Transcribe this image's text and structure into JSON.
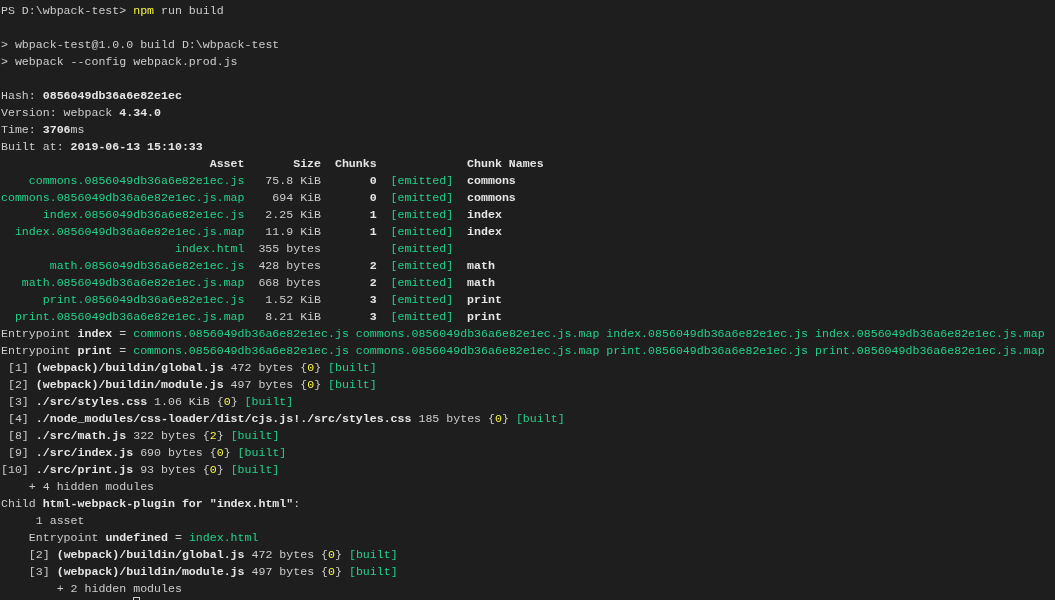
{
  "terminal": {
    "lines_before": [
      {
        "kind": "text",
        "segments": [
          {
            "text": "PS D:\\wbpack-test> "
          },
          {
            "text": "npm",
            "kind": "command"
          },
          {
            "text": " run build"
          }
        ]
      },
      {
        "kind": "blank"
      },
      {
        "kind": "text",
        "segments": [
          {
            "text": "> wbpack-test@1.0.0 build D:\\wbpack-test"
          }
        ]
      },
      {
        "kind": "text",
        "segments": [
          {
            "text": "> webpack --config webpack.prod.js"
          }
        ]
      },
      {
        "kind": "blank"
      },
      {
        "kind": "text",
        "segments": [
          {
            "text": "Hash: "
          },
          {
            "text": "0856049db36a6e82e1ec",
            "kind": "value"
          }
        ]
      },
      {
        "kind": "text",
        "segments": [
          {
            "text": "Version: webpack "
          },
          {
            "text": "4.34.0",
            "kind": "value"
          }
        ]
      },
      {
        "kind": "text",
        "segments": [
          {
            "text": "Time: "
          },
          {
            "text": "3706",
            "kind": "value"
          },
          {
            "text": "ms"
          }
        ]
      },
      {
        "kind": "text",
        "segments": [
          {
            "text": "Built at: "
          },
          {
            "text": "2019-06-13 15:10:33",
            "kind": "value"
          }
        ]
      }
    ],
    "asset_table": {
      "header": {
        "asset": "Asset",
        "size": "Size",
        "chunks": "Chunks",
        "chunk_names": "Chunk Names"
      },
      "rows": [
        {
          "asset": "commons.0856049db36a6e82e1ec.js",
          "size": "75.8 KiB",
          "chunks": "0",
          "status": "[emitted]",
          "chunk_names": "commons"
        },
        {
          "asset": "commons.0856049db36a6e82e1ec.js.map",
          "size": "694 KiB",
          "chunks": "0",
          "status": "[emitted]",
          "chunk_names": "commons"
        },
        {
          "asset": "index.0856049db36a6e82e1ec.js",
          "size": "2.25 KiB",
          "chunks": "1",
          "status": "[emitted]",
          "chunk_names": "index"
        },
        {
          "asset": "index.0856049db36a6e82e1ec.js.map",
          "size": "11.9 KiB",
          "chunks": "1",
          "status": "[emitted]",
          "chunk_names": "index"
        },
        {
          "asset": "index.html",
          "size": "355 bytes",
          "status": "[emitted]"
        },
        {
          "asset": "math.0856049db36a6e82e1ec.js",
          "size": "428 bytes",
          "chunks": "2",
          "status": "[emitted]",
          "chunk_names": "math"
        },
        {
          "asset": "math.0856049db36a6e82e1ec.js.map",
          "size": "668 bytes",
          "chunks": "2",
          "status": "[emitted]",
          "chunk_names": "math"
        },
        {
          "asset": "print.0856049db36a6e82e1ec.js",
          "size": "1.52 KiB",
          "chunks": "3",
          "status": "[emitted]",
          "chunk_names": "print"
        },
        {
          "asset": "print.0856049db36a6e82e1ec.js.map",
          "size": "8.21 KiB",
          "chunks": "3",
          "status": "[emitted]",
          "chunk_names": "print"
        }
      ]
    },
    "lines_after": [
      {
        "kind": "text",
        "segments": [
          {
            "text": "Entrypoint "
          },
          {
            "text": "index",
            "kind": "value"
          },
          {
            "text": " = "
          },
          {
            "text": "commons.0856049db36a6e82e1ec.js commons.0856049db36a6e82e1ec.js.map index.0856049db36a6e82e1ec.js index.0856049db36a6e82e1ec.js.map",
            "kind": "file"
          }
        ]
      },
      {
        "kind": "text",
        "segments": [
          {
            "text": "Entrypoint "
          },
          {
            "text": "print",
            "kind": "value"
          },
          {
            "text": " = "
          },
          {
            "text": "commons.0856049db36a6e82e1ec.js commons.0856049db36a6e82e1ec.js.map print.0856049db36a6e82e1ec.js print.0856049db36a6e82e1ec.js.map",
            "kind": "file"
          }
        ]
      },
      {
        "kind": "text",
        "segments": [
          {
            "text": " [1] "
          },
          {
            "text": "(webpack)/buildin/global.js",
            "kind": "value"
          },
          {
            "text": " 472 bytes {"
          },
          {
            "text": "0",
            "kind": "chunk"
          },
          {
            "text": "} "
          },
          {
            "text": "[built]",
            "kind": "status"
          }
        ]
      },
      {
        "kind": "text",
        "segments": [
          {
            "text": " [2] "
          },
          {
            "text": "(webpack)/buildin/module.js",
            "kind": "value"
          },
          {
            "text": " 497 bytes {"
          },
          {
            "text": "0",
            "kind": "chunk"
          },
          {
            "text": "} "
          },
          {
            "text": "[built]",
            "kind": "status"
          }
        ]
      },
      {
        "kind": "text",
        "segments": [
          {
            "text": " [3] "
          },
          {
            "text": "./src/styles.css",
            "kind": "value"
          },
          {
            "text": " 1.06 KiB {"
          },
          {
            "text": "0",
            "kind": "chunk"
          },
          {
            "text": "} "
          },
          {
            "text": "[built]",
            "kind": "status"
          }
        ]
      },
      {
        "kind": "text",
        "segments": [
          {
            "text": " [4] "
          },
          {
            "text": "./node_modules/css-loader/dist/cjs.js!./src/styles.css",
            "kind": "value"
          },
          {
            "text": " 185 bytes {"
          },
          {
            "text": "0",
            "kind": "chunk"
          },
          {
            "text": "} "
          },
          {
            "text": "[built]",
            "kind": "status"
          }
        ]
      },
      {
        "kind": "text",
        "segments": [
          {
            "text": " [8] "
          },
          {
            "text": "./src/math.js",
            "kind": "value"
          },
          {
            "text": " 322 bytes {"
          },
          {
            "text": "2",
            "kind": "chunk"
          },
          {
            "text": "} "
          },
          {
            "text": "[built]",
            "kind": "status"
          }
        ]
      },
      {
        "kind": "text",
        "segments": [
          {
            "text": " [9] "
          },
          {
            "text": "./src/index.js",
            "kind": "value"
          },
          {
            "text": " 690 bytes {"
          },
          {
            "text": "0",
            "kind": "chunk"
          },
          {
            "text": "} "
          },
          {
            "text": "[built]",
            "kind": "status"
          }
        ]
      },
      {
        "kind": "text",
        "segments": [
          {
            "text": "[10] "
          },
          {
            "text": "./src/print.js",
            "kind": "value"
          },
          {
            "text": " 93 bytes {"
          },
          {
            "text": "0",
            "kind": "chunk"
          },
          {
            "text": "} "
          },
          {
            "text": "[built]",
            "kind": "status"
          }
        ]
      },
      {
        "kind": "text",
        "segments": [
          {
            "text": "    + 4 hidden modules"
          }
        ]
      },
      {
        "kind": "text",
        "segments": [
          {
            "text": "Child "
          },
          {
            "text": "html-webpack-plugin for \"index.html\"",
            "kind": "value"
          },
          {
            "text": ":"
          }
        ]
      },
      {
        "kind": "text",
        "segments": [
          {
            "text": "     1 asset"
          }
        ]
      },
      {
        "kind": "text",
        "segments": [
          {
            "text": "    Entrypoint "
          },
          {
            "text": "undefined",
            "kind": "value"
          },
          {
            "text": " = "
          },
          {
            "text": "index.html",
            "kind": "file"
          }
        ]
      },
      {
        "kind": "text",
        "segments": [
          {
            "text": "    [2] "
          },
          {
            "text": "(webpack)/buildin/global.js",
            "kind": "value"
          },
          {
            "text": " 472 bytes {"
          },
          {
            "text": "0",
            "kind": "chunk"
          },
          {
            "text": "} "
          },
          {
            "text": "[built]",
            "kind": "status"
          }
        ]
      },
      {
        "kind": "text",
        "segments": [
          {
            "text": "    [3] "
          },
          {
            "text": "(webpack)/buildin/module.js",
            "kind": "value"
          },
          {
            "text": " 497 bytes {"
          },
          {
            "text": "0",
            "kind": "chunk"
          },
          {
            "text": "} "
          },
          {
            "text": "[built]",
            "kind": "status"
          }
        ]
      },
      {
        "kind": "text",
        "segments": [
          {
            "text": "        + 2 hidden modules"
          }
        ]
      }
    ]
  }
}
